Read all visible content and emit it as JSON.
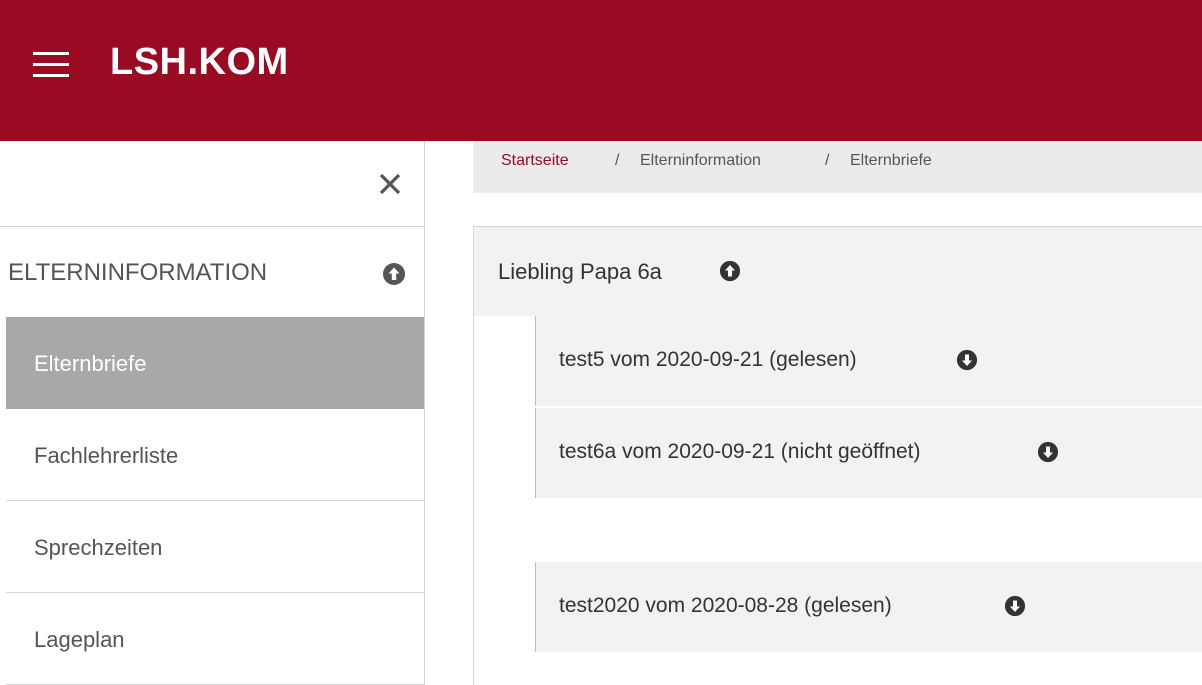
{
  "header": {
    "brand": "LSH.KOM",
    "background_color": "#990b22",
    "menu_icon": "hamburger-icon"
  },
  "sidebar": {
    "close_icon": "close-icon",
    "section": {
      "label": "ELTERNINFORMATION",
      "icon": "circle-arrow-up-icon"
    },
    "items": [
      {
        "label": "Elternbriefe",
        "active": true
      },
      {
        "label": "Fachlehrerliste",
        "active": false
      },
      {
        "label": "Sprechzeiten",
        "active": false
      },
      {
        "label": "Lageplan",
        "active": false
      }
    ]
  },
  "breadcrumb": {
    "items": [
      "Startseite",
      "Elterninformation",
      "Elternbriefe"
    ],
    "separator": "/",
    "link_color": "#990b22"
  },
  "main": {
    "group": {
      "title": "Liebling Papa 6a",
      "icon": "circle-arrow-up-icon",
      "letters": [
        {
          "title": "test5 vom 2020-09-21 (gelesen)",
          "icon": "circle-arrow-down-icon"
        },
        {
          "title": "test6a vom 2020-09-21 (nicht geöffnet)",
          "icon": "circle-arrow-down-icon"
        },
        {
          "title": "test2020 vom 2020-08-28 (gelesen)",
          "icon": "circle-arrow-down-icon"
        }
      ]
    }
  }
}
